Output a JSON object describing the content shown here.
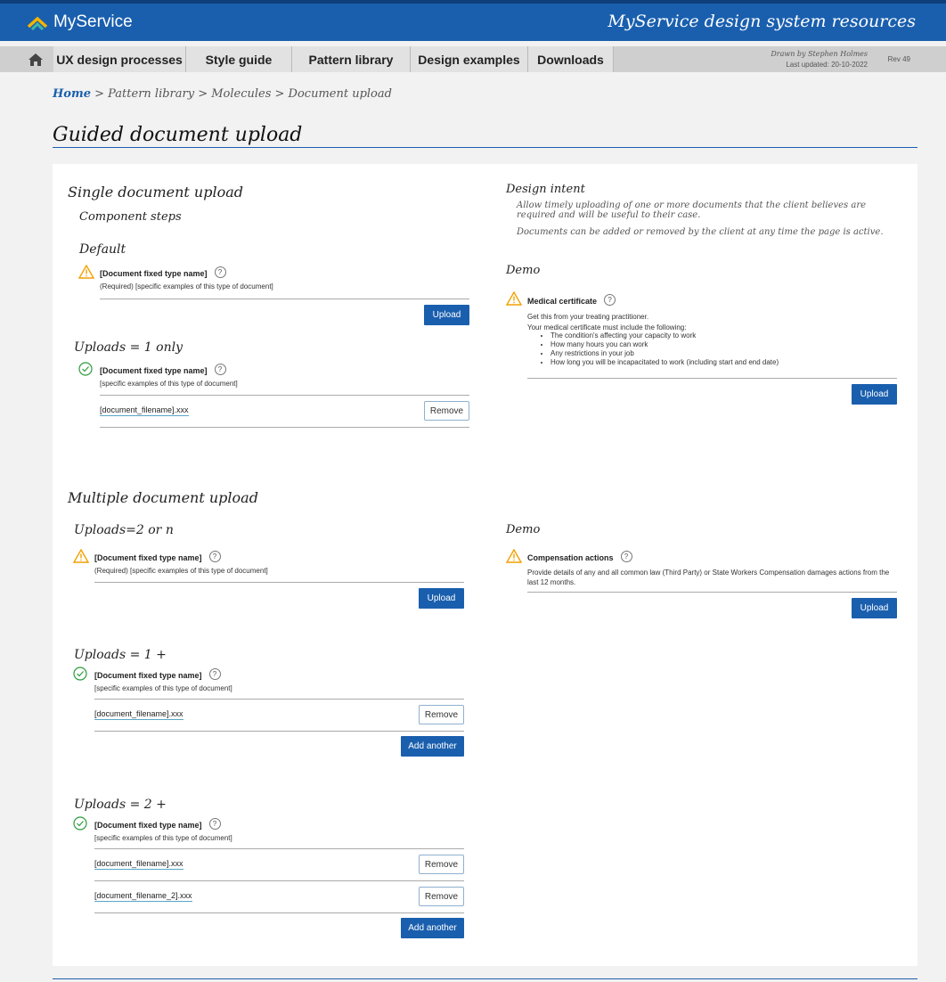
{
  "header": {
    "brand": "MyService",
    "site_title": "MyService design system resources"
  },
  "nav": {
    "home_icon": "home-icon",
    "tabs": [
      {
        "label": "UX design processes"
      },
      {
        "label": "Style guide"
      },
      {
        "label": "Pattern library"
      },
      {
        "label": "Design examples"
      },
      {
        "label": "Downloads"
      }
    ],
    "drawn_by": "Drawn by Stephen Holmes",
    "last_updated": "Last updated: 20-10-2022",
    "rev": "Rev 49"
  },
  "breadcrumb": {
    "home": "Home",
    "rest": " > Pattern library > Molecules > Document upload"
  },
  "page_title": "Guided document upload",
  "single": {
    "heading": "Single document upload",
    "component_steps": "Component steps",
    "default": {
      "title": "Default",
      "name": "[Document fixed type name]",
      "desc": "(Required) [specific examples of this type of document]",
      "upload": "Upload"
    },
    "one_only": {
      "title": "Uploads = 1 only",
      "name": "[Document fixed type name]",
      "desc": "[specific examples of this type of document]",
      "filename": "[document_filename].xxx",
      "remove": "Remove"
    }
  },
  "design_intent": {
    "title": "Design intent",
    "p1": "Allow timely uploading of one or more documents that the client believes are required and will be useful to their case.",
    "p2": "Documents can be added or removed by the client at any time the page is active."
  },
  "demo1": {
    "title": "Demo",
    "name": "Medical certificate",
    "line1": "Get this from your treating practitioner.",
    "line2": "Your medical certificate must include the following:",
    "items": [
      "The condition's affecting your capacity to work",
      "How many hours you can work",
      "Any restrictions in your job",
      "How long you will be incapacitated to work (including start and end date)"
    ],
    "upload": "Upload"
  },
  "multiple": {
    "heading": "Multiple document upload",
    "two_or_n": {
      "title": "Uploads=2 or n",
      "name": "[Document fixed type name]",
      "desc": "(Required) [specific examples of this type of document]",
      "upload": "Upload"
    },
    "one_plus": {
      "title": "Uploads = 1 +",
      "name": "[Document fixed type name]",
      "desc": "[specific examples of this type of document]",
      "filename": "[document_filename].xxx",
      "remove": "Remove",
      "add": "Add another"
    },
    "two_plus": {
      "title": "Uploads = 2 +",
      "name": "[Document fixed type name]",
      "desc": "[specific examples of this type of document]",
      "filename1": "[document_filename].xxx",
      "filename2": "[document_filename_2].xxx",
      "remove": "Remove",
      "add": "Add another"
    }
  },
  "demo2": {
    "title": "Demo",
    "name": "Compensation actions",
    "desc": "Provide details of any and all common law (Third Party) or State Workers Compensation damages actions from the last 12 months.",
    "upload": "Upload"
  },
  "colors": {
    "brand_blue": "#1a5fae",
    "warning": "#f2a100",
    "success": "#2e9b3e"
  }
}
